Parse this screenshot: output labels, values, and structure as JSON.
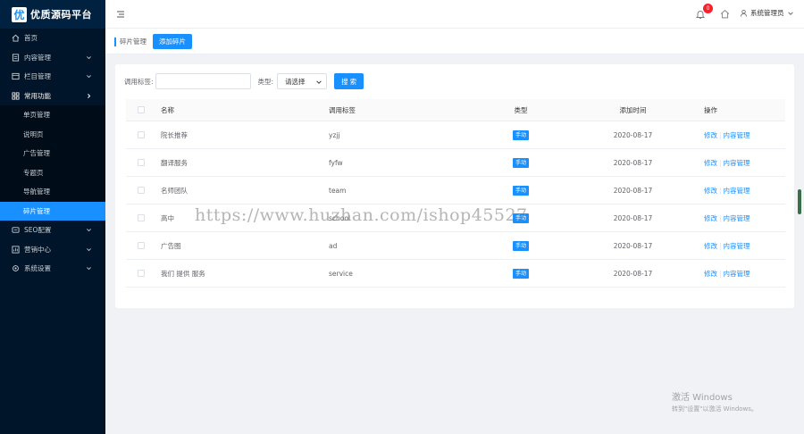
{
  "brand": {
    "logo_char": "优",
    "name": "优质源码平台"
  },
  "sidebar": {
    "items": [
      {
        "label": "首页",
        "icon": "home-icon"
      },
      {
        "label": "内容管理",
        "icon": "file-icon",
        "caret": "chevron-down-icon"
      },
      {
        "label": "栏目管理",
        "icon": "columns-icon",
        "caret": "chevron-down-icon"
      },
      {
        "label": "常用功能",
        "icon": "grid-icon",
        "caret": "chevron-right-icon"
      }
    ],
    "sub_items": [
      "单页管理",
      "说明页",
      "广告管理",
      "专题页",
      "导航管理",
      "碎片管理"
    ],
    "items_after": [
      {
        "label": "SEO配置",
        "icon": "seo-icon",
        "caret": "chevron-down-icon"
      },
      {
        "label": "营销中心",
        "icon": "marketing-icon",
        "caret": "chevron-down-icon"
      },
      {
        "label": "系统设置",
        "icon": "gear-icon",
        "caret": "chevron-down-icon"
      }
    ]
  },
  "header": {
    "notification_count": "0",
    "user_name": "系统管理员"
  },
  "breadcrumb": {
    "current": "碎片管理",
    "add_button": "添加碎片"
  },
  "search": {
    "tag_label": "调用标签:",
    "tag_value": "",
    "type_label": "类型:",
    "type_selected": "请选择",
    "button": "搜 索"
  },
  "table": {
    "headers": {
      "name": "名称",
      "tag": "调用标签",
      "type": "类型",
      "date": "添加时间",
      "ops": "操作"
    },
    "rows": [
      {
        "name": "院长推荐",
        "tag": "yzjj",
        "type": "手动",
        "date": "2020-08-17"
      },
      {
        "name": "翻译服务",
        "tag": "fyfw",
        "type": "手动",
        "date": "2020-08-17"
      },
      {
        "name": "名师团队",
        "tag": "team",
        "type": "手动",
        "date": "2020-08-17"
      },
      {
        "name": "高中",
        "tag": "school",
        "type": "手动",
        "date": "2020-08-17"
      },
      {
        "name": "广告图",
        "tag": "ad",
        "type": "手动",
        "date": "2020-08-17"
      },
      {
        "name": "我们 提供 服务",
        "tag": "service",
        "type": "手动",
        "date": "2020-08-17"
      }
    ],
    "op_edit": "修改",
    "op_sep": "|",
    "op_content": "内容管理"
  },
  "watermark": "https://www.huzhan.com/ishop45527",
  "activation": {
    "line1": "激活 Windows",
    "line2": "转到\"设置\"以激活 Windows。"
  },
  "colors": {
    "sidebar_bg": "#001529",
    "accent": "#1890ff",
    "badge": "#f5222d"
  }
}
